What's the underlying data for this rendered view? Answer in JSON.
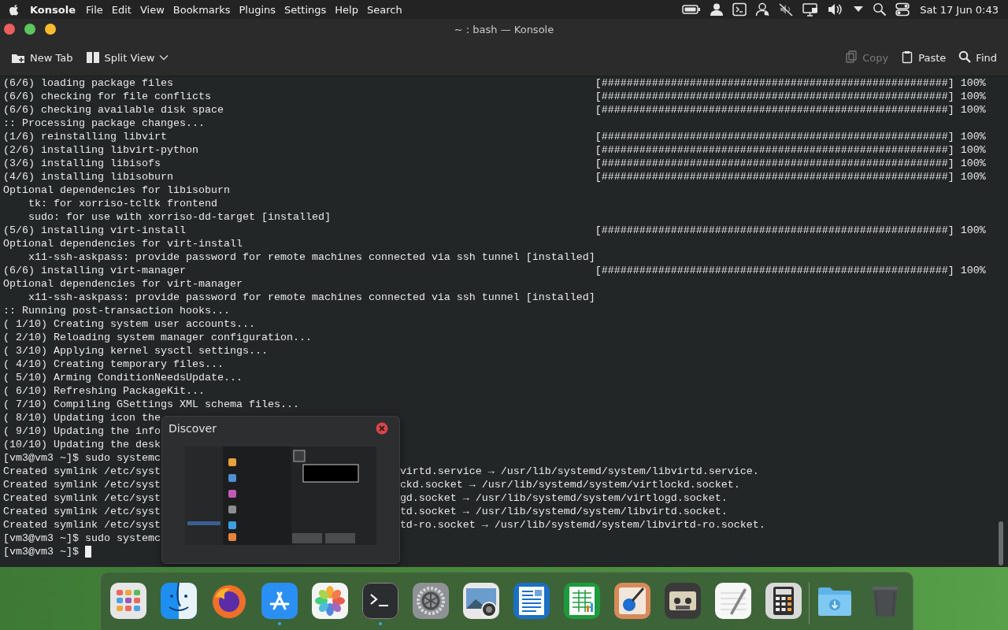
{
  "menu_bar": {
    "app_name": "Konsole",
    "menus": [
      "File",
      "Edit",
      "View",
      "Bookmarks",
      "Plugins",
      "Settings",
      "Help",
      "Search"
    ],
    "clock": "Sat 17 Jun 0:43"
  },
  "window": {
    "title": "~ : bash — Konsole"
  },
  "toolbar": {
    "left": [
      {
        "label": "New Tab",
        "disabled": false
      },
      {
        "label": "Split View",
        "disabled": false
      }
    ],
    "right": [
      {
        "label": "Copy",
        "disabled": true
      },
      {
        "label": "Paste",
        "disabled": false
      },
      {
        "label": "Find",
        "disabled": false
      }
    ]
  },
  "terminal": {
    "lines": [
      {
        "text": "(6/6) loading package files",
        "bar": "[#######################################################]",
        "percent": "100%"
      },
      {
        "text": "(6/6) checking for file conflicts",
        "bar": "[#######################################################]",
        "percent": "100%"
      },
      {
        "text": "(6/6) checking available disk space",
        "bar": "[#######################################################]",
        "percent": "100%"
      },
      {
        "text": ":: Processing package changes..."
      },
      {
        "text": "(1/6) reinstalling libvirt",
        "bar": "[#######################################################]",
        "percent": "100%"
      },
      {
        "text": "(2/6) installing libvirt-python",
        "bar": "[#######################################################]",
        "percent": "100%"
      },
      {
        "text": "(3/6) installing libisofs",
        "bar": "[#######################################################]",
        "percent": "100%"
      },
      {
        "text": "(4/6) installing libisoburn",
        "bar": "[#######################################################]",
        "percent": "100%"
      },
      {
        "text": "Optional dependencies for libisoburn"
      },
      {
        "text": "    tk: for xorriso-tcltk frontend"
      },
      {
        "text": "    sudo: for use with xorriso-dd-target [installed]"
      },
      {
        "text": "(5/6) installing virt-install",
        "bar": "[#######################################################]",
        "percent": "100%"
      },
      {
        "text": "Optional dependencies for virt-install"
      },
      {
        "text": "    x11-ssh-askpass: provide password for remote machines connected via ssh tunnel [installed]"
      },
      {
        "text": "(6/6) installing virt-manager",
        "bar": "[#######################################################]",
        "percent": "100%"
      },
      {
        "text": "Optional dependencies for virt-manager"
      },
      {
        "text": "    x11-ssh-askpass: provide password for remote machines connected via ssh tunnel [installed]"
      },
      {
        "text": ":: Running post-transaction hooks..."
      },
      {
        "text": "( 1/10) Creating system user accounts..."
      },
      {
        "text": "( 2/10) Reloading system manager configuration..."
      },
      {
        "text": "( 3/10) Applying kernel sysctl settings..."
      },
      {
        "text": "( 4/10) Creating temporary files..."
      },
      {
        "text": "( 5/10) Arming ConditionNeedsUpdate..."
      },
      {
        "text": "( 6/10) Refreshing PackageKit..."
      },
      {
        "text": "( 7/10) Compiling GSettings XML schema files..."
      },
      {
        "text": "( 8/10) Updating icon the"
      },
      {
        "text": "( 9/10) Updating the info"
      },
      {
        "text": "(10/10) Updating the desk"
      },
      {
        "text": "[vm3@vm3 ~]$ sudo systemc"
      },
      {
        "text": "Created symlink /etc/syst",
        "text_right": "virtd.service → /usr/lib/systemd/system/libvirtd.service."
      },
      {
        "text": "Created symlink /etc/syst",
        "text_right": "ckd.socket → /usr/lib/systemd/system/virtlockd.socket."
      },
      {
        "text": "Created symlink /etc/syst",
        "text_right": "gd.socket → /usr/lib/systemd/system/virtlogd.socket."
      },
      {
        "text": "Created symlink /etc/syst",
        "text_right": "td.socket → /usr/lib/systemd/system/libvirtd.socket."
      },
      {
        "text": "Created symlink /etc/syst",
        "text_right": "td-ro.socket → /usr/lib/systemd/system/libvirtd-ro.socket."
      },
      {
        "text": "[vm3@vm3 ~]$ sudo systemc"
      },
      {
        "text": "[vm3@vm3 ~]$ ",
        "cursor": true
      }
    ]
  },
  "preview_popup": {
    "title": "Discover"
  },
  "dock": {
    "items": [
      {
        "running": false
      },
      {
        "running": false
      },
      {
        "running": false
      },
      {
        "running": true
      },
      {
        "running": false
      },
      {
        "running": true
      },
      {
        "running": false
      },
      {
        "running": false
      },
      {
        "running": false
      },
      {
        "running": false
      },
      {
        "running": false
      },
      {
        "running": false
      },
      {
        "running": false
      },
      {
        "running": false
      },
      {
        "running": false
      },
      {
        "running": false
      }
    ]
  }
}
